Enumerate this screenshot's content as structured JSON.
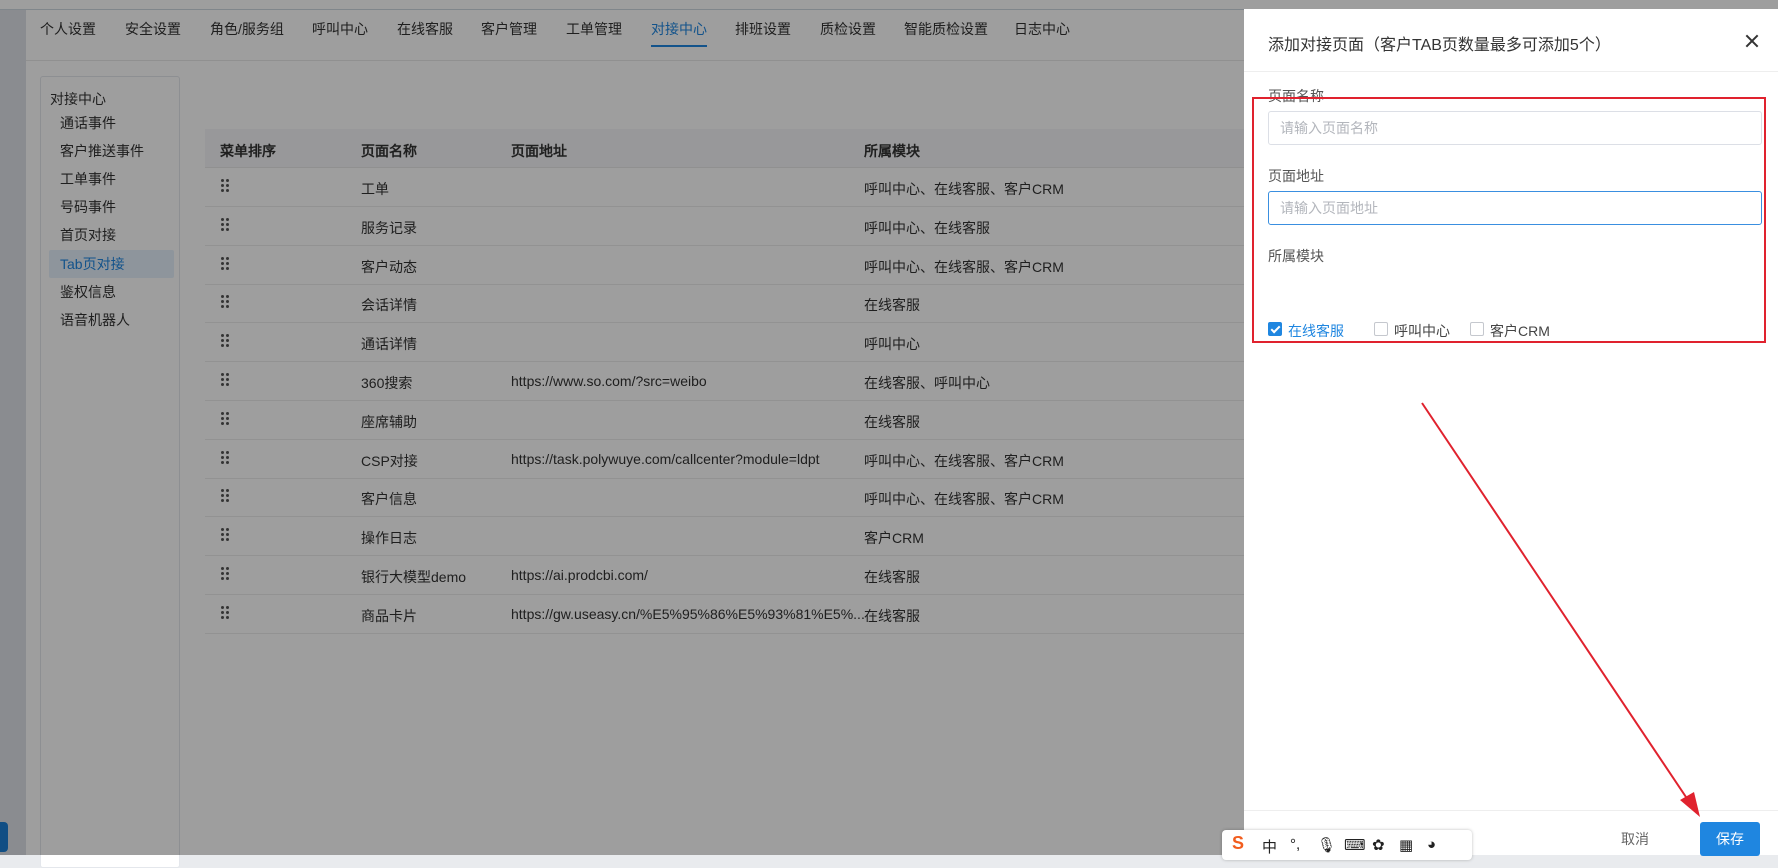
{
  "topnav": {
    "tabs": [
      {
        "label": "个人设置"
      },
      {
        "label": "安全设置"
      },
      {
        "label": "角色/服务组"
      },
      {
        "label": "呼叫中心"
      },
      {
        "label": "在线客服"
      },
      {
        "label": "客户管理"
      },
      {
        "label": "工单管理"
      },
      {
        "label": "对接中心",
        "active": true
      },
      {
        "label": "排班设置"
      },
      {
        "label": "质检设置"
      },
      {
        "label": "智能质检设置"
      },
      {
        "label": "日志中心"
      }
    ]
  },
  "sidebar": {
    "title": "对接中心",
    "items": [
      {
        "label": "通话事件"
      },
      {
        "label": "客户推送事件"
      },
      {
        "label": "工单事件"
      },
      {
        "label": "号码事件"
      },
      {
        "label": "首页对接"
      },
      {
        "label": "Tab页对接",
        "active": true
      },
      {
        "label": "鉴权信息"
      },
      {
        "label": "语音机器人"
      }
    ]
  },
  "table": {
    "headers": {
      "order": "菜单排序",
      "name": "页面名称",
      "url": "页面地址",
      "module": "所属模块"
    },
    "rows": [
      {
        "name": "工单",
        "url": "",
        "module": "呼叫中心、在线客服、客户CRM"
      },
      {
        "name": "服务记录",
        "url": "",
        "module": "呼叫中心、在线客服"
      },
      {
        "name": "客户动态",
        "url": "",
        "module": "呼叫中心、在线客服、客户CRM"
      },
      {
        "name": "会话详情",
        "url": "",
        "module": "在线客服"
      },
      {
        "name": "通话详情",
        "url": "",
        "module": "呼叫中心"
      },
      {
        "name": "360搜索",
        "url": "https://www.so.com/?src=weibo",
        "module": "在线客服、呼叫中心"
      },
      {
        "name": "座席辅助",
        "url": "",
        "module": "在线客服"
      },
      {
        "name": "CSP对接",
        "url": "https://task.polywuye.com/callcenter?module=ldpt",
        "module": "呼叫中心、在线客服、客户CRM"
      },
      {
        "name": "客户信息",
        "url": "",
        "module": "呼叫中心、在线客服、客户CRM"
      },
      {
        "name": "操作日志",
        "url": "",
        "module": "客户CRM"
      },
      {
        "name": "银行大模型demo",
        "url": "https://ai.prodcbi.com/",
        "module": "在线客服"
      },
      {
        "name": "商品卡片",
        "url": "https://gw.useasy.cn/%E5%95%86%E5%93%81%E5%...",
        "module": "在线客服"
      }
    ]
  },
  "drawer": {
    "title": "添加对接页面（客户TAB页数量最多可添加5个）",
    "page_name": {
      "label": "页面名称",
      "placeholder": "请输入页面名称",
      "value": ""
    },
    "page_url": {
      "label": "页面地址",
      "placeholder": "请输入页面地址",
      "value": ""
    },
    "module": {
      "label": "所属模块",
      "options": [
        {
          "label": "在线客服",
          "checked": true
        },
        {
          "label": "呼叫中心",
          "checked": false
        },
        {
          "label": "客户CRM",
          "checked": false
        }
      ]
    },
    "cancel_label": "取消",
    "save_label": "保存"
  },
  "annotation": {
    "color": "#e0222e"
  },
  "ime": {
    "lang": "中"
  }
}
